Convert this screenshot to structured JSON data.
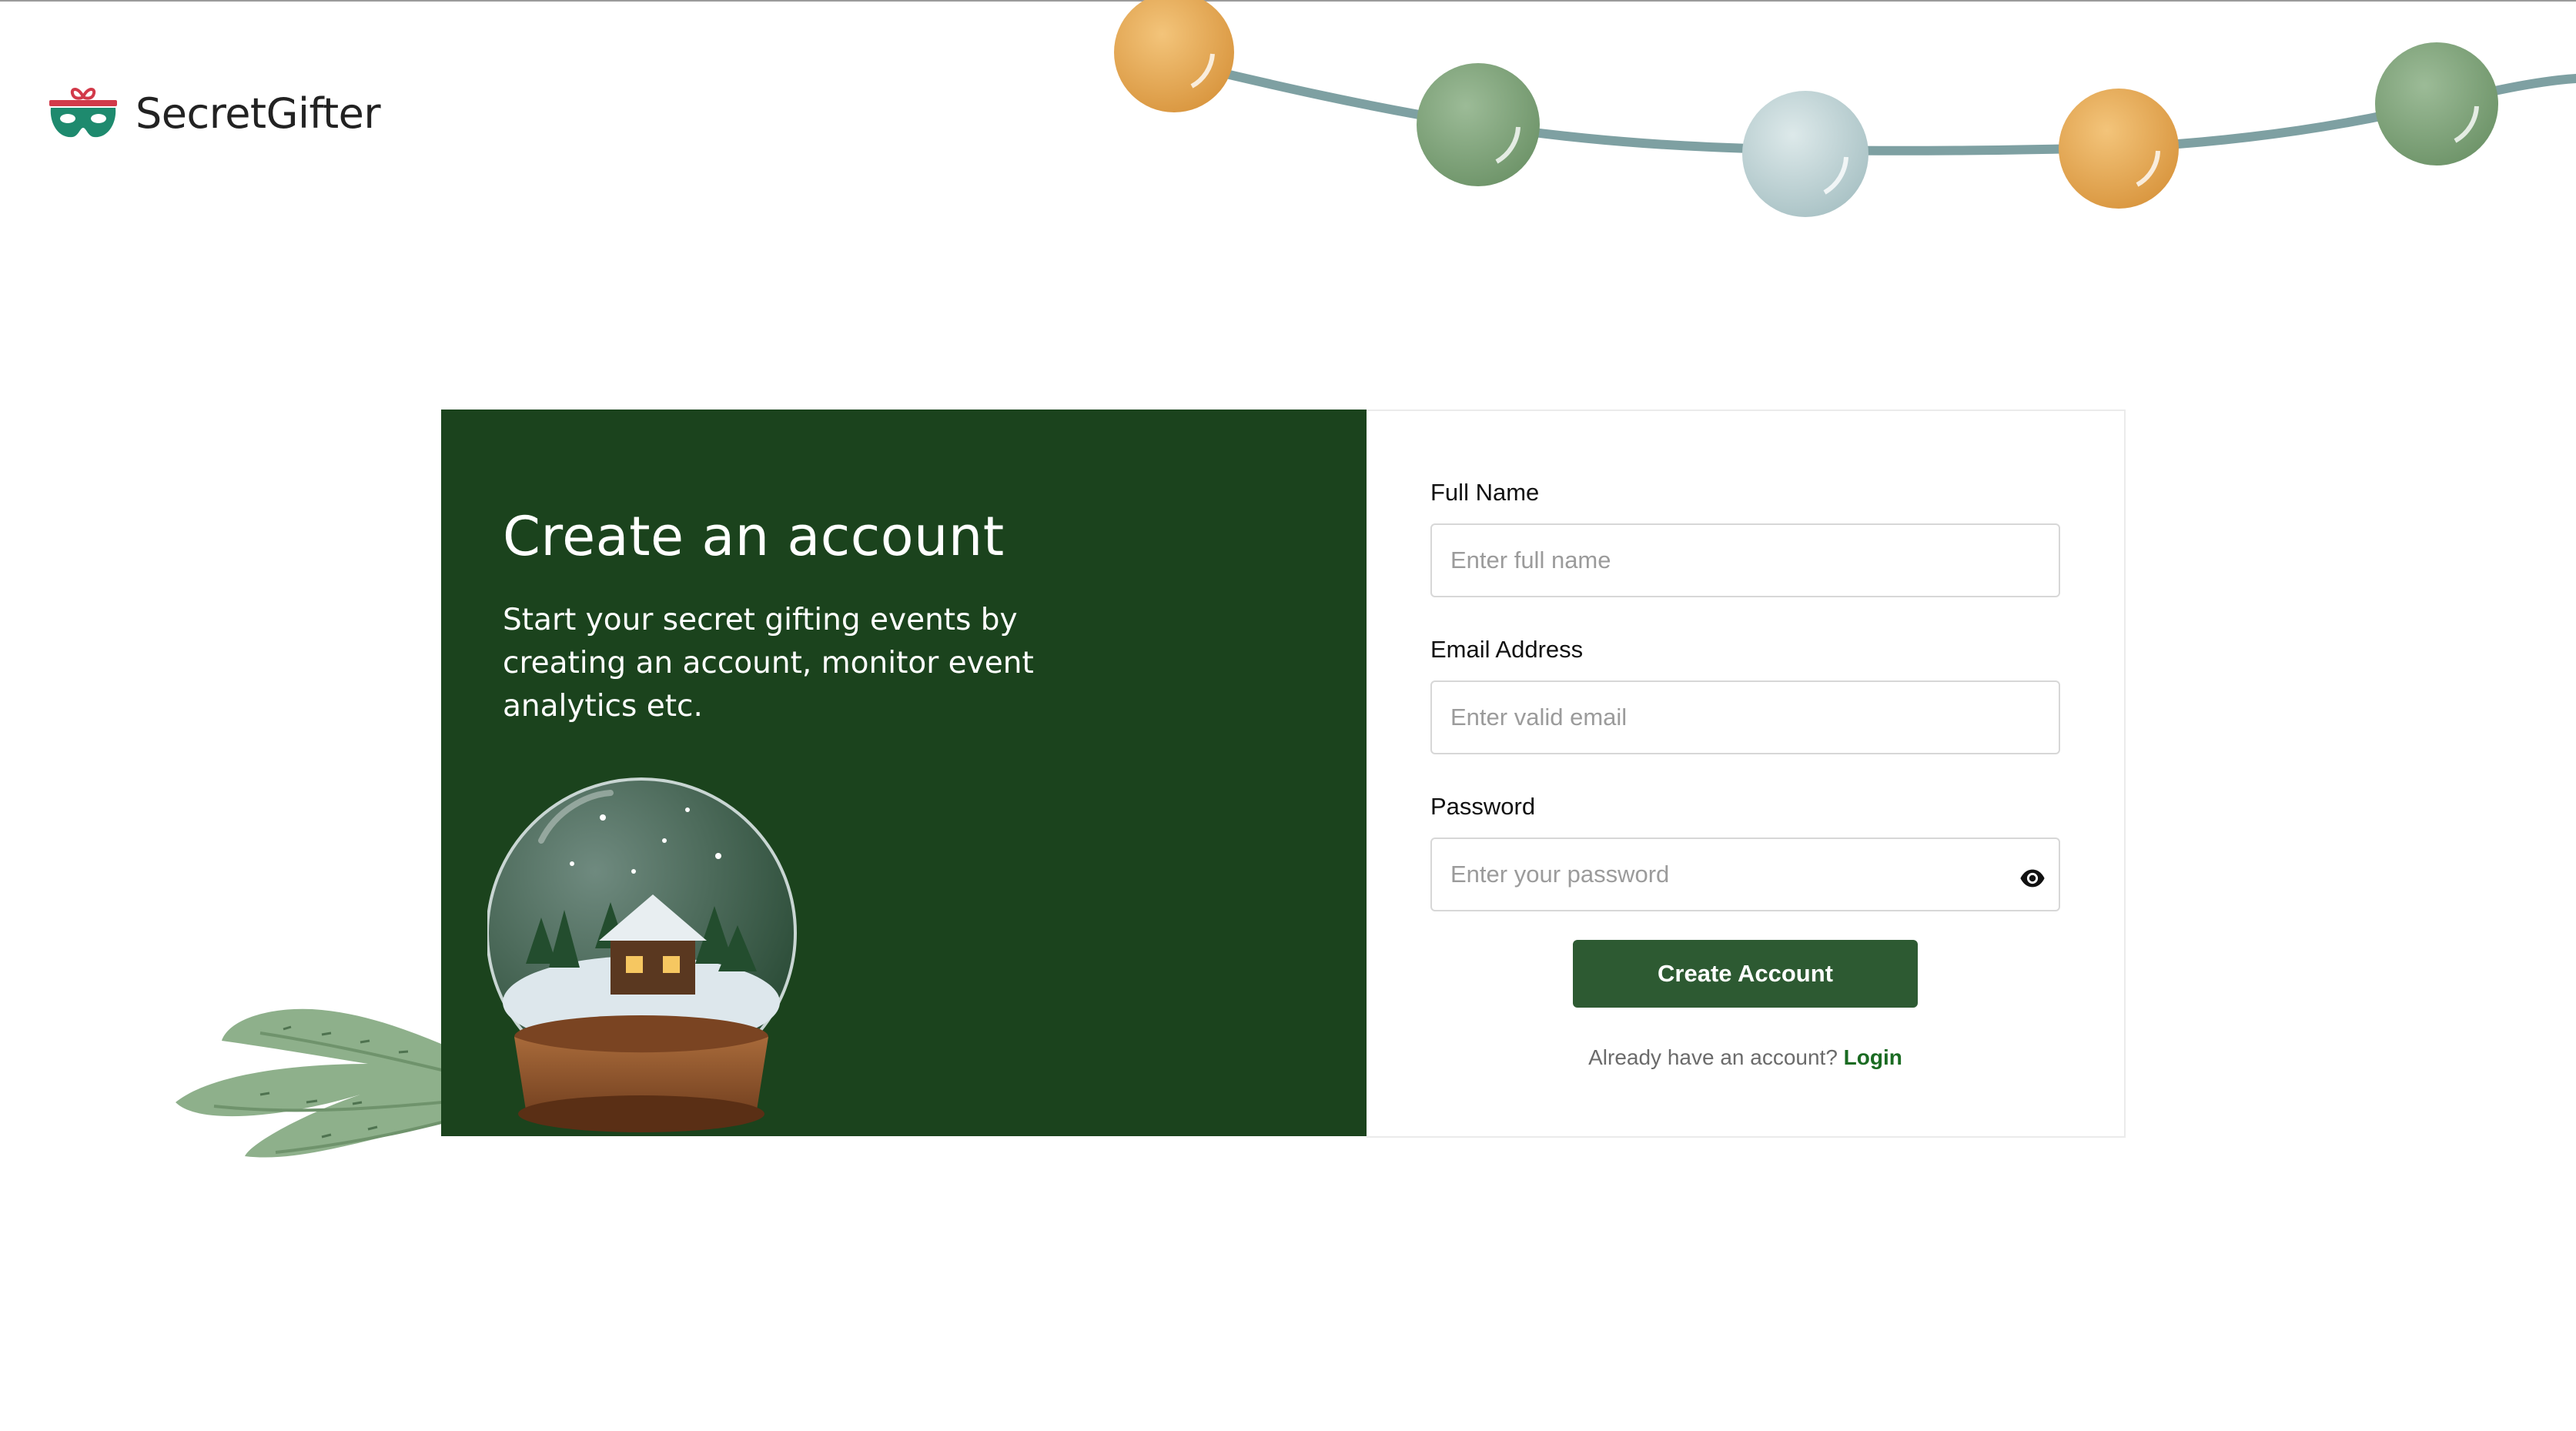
{
  "brand": {
    "name": "SecretGifter"
  },
  "hero": {
    "title": "Create an account",
    "subtitle": "Start your secret gifting events by creating an account, monitor event analytics etc."
  },
  "form": {
    "full_name": {
      "label": "Full Name",
      "placeholder": "Enter full name"
    },
    "email": {
      "label": "Email Address",
      "placeholder": "Enter valid email"
    },
    "password": {
      "label": "Password",
      "placeholder": "Enter your password"
    },
    "submit_label": "Create Account",
    "login_prompt": "Already have an account?",
    "login_link": "Login"
  },
  "icons": {
    "brand": "mask-gift-icon",
    "password_toggle": "eye-icon"
  },
  "colors": {
    "panel": "#1b431d",
    "button": "#2d5a32",
    "link": "#1a6b22",
    "brand_teal": "#1e8a6e",
    "brand_red": "#d23a4a",
    "ornament_orange": "#eaaa55",
    "ornament_green": "#86a882",
    "ornament_pale": "#c6d8da"
  }
}
